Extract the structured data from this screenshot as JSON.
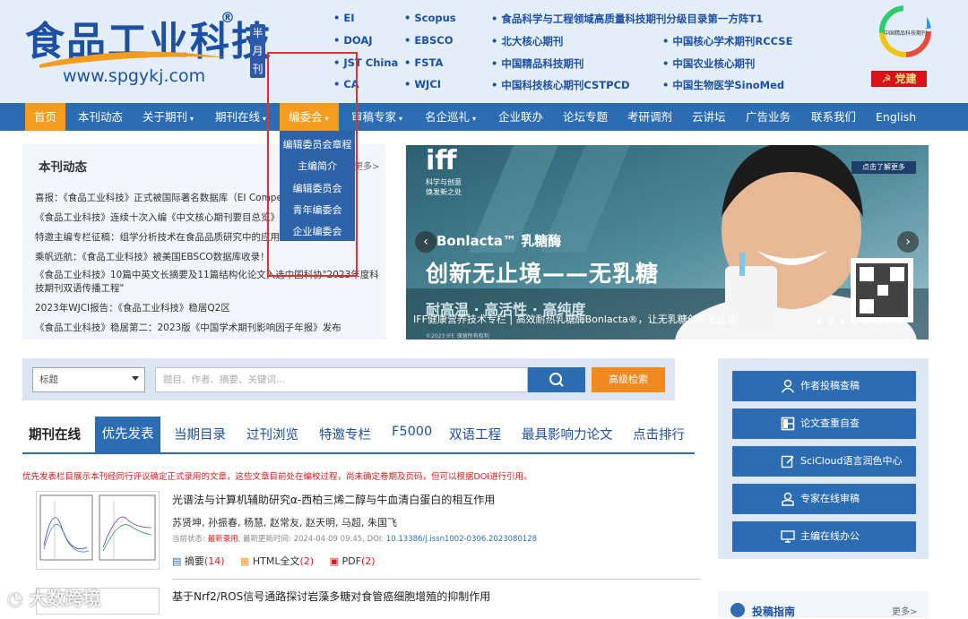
{
  "header": {
    "logo_text": "食品工业科技",
    "logo_url": "www.spgykj.com",
    "halfmonth": "半月刊",
    "index_col1": [
      "EI",
      "DOAJ",
      "JST China",
      "CA"
    ],
    "index_col2": [
      "Scopus",
      "EBSCO",
      "FSTA",
      "WJCI"
    ],
    "index_col3": [
      "食品科学与工程领域高质量科技期刊分级目录第一方阵T1",
      "北大核心期刊",
      "中国精品科技期刊",
      "中国科技核心期刊CSTPCD"
    ],
    "index_col4": [
      "中国核心学术期刊RCCSE",
      "中国农业核心期刊",
      "中国生物医学SinoMed"
    ],
    "party_button": "党建",
    "cert_text": "中国精品科技期刊"
  },
  "nav": {
    "items": [
      {
        "label": "首页"
      },
      {
        "label": "本刊动态"
      },
      {
        "label": "关于期刊"
      },
      {
        "label": "期刊在线"
      },
      {
        "label": "编委会"
      },
      {
        "label": "审稿专家"
      },
      {
        "label": "名企巡礼"
      },
      {
        "label": "企业联办"
      },
      {
        "label": "论坛专题"
      },
      {
        "label": "考研调剂"
      },
      {
        "label": "云讲坛"
      },
      {
        "label": "广告业务"
      },
      {
        "label": "联系我们"
      },
      {
        "label": "English"
      }
    ]
  },
  "dropdown": {
    "items": [
      "编辑委员会章程",
      "主编简介",
      "编辑委员会",
      "青年编委会",
      "企业编委会"
    ]
  },
  "news": {
    "title": "本刊动态",
    "more": "更多>",
    "items": [
      "喜报：《食品工业科技》正式被国际著名数据库（EI Compendex）收录",
      "《食品工业科技》连续十次入编《中文核心期刊要目总览》",
      "特邀主编专栏征稿：组学分析技术在食品品质研究中的应用",
      "乘帆远航：《食品工业科技》被美国EBSCO数据库收录！",
      "《食品工业科技》10篇中英文长摘要及11篇结构化论文入选中国科协\"2023年度科技期刊双语传播工程\"",
      "2023年WJCI报告：《食品工业科技》稳居Q2区",
      "《食品工业科技》稳居第二：2023版《中国学术期刊影响因子年报》发布"
    ]
  },
  "banner": {
    "brand": "iff",
    "brand_sub": "科学与创意\n焕发新之处",
    "product": "Bonlacta™ 乳糖酶",
    "slogan": "创新无止境——无乳糖",
    "tagline": "耐高温 · 高活性 · 高纯度",
    "cta": "点击了解更多",
    "caption": "IFF健康营养技术专栏 | 高效耐热乳糖酶Bonlacta®，让无乳糖创新无止境",
    "copyright": "©2023 IFF. 保留所有权利",
    "active_dot": 0,
    "dot_count": 8
  },
  "search": {
    "select_value": "标题",
    "placeholder": "题目、作者、摘要、关键词...",
    "advanced_label": "高级检索"
  },
  "tabs": {
    "items": [
      "期刊在线",
      "优先发表",
      "当期目录",
      "过刊浏览",
      "特邀专栏",
      "F5000",
      "双语工程",
      "最具影响力论文",
      "点击排行"
    ],
    "active": "优先发表"
  },
  "notice": "优先发表栏目展示本刊经同行评议确定正式录用的文章，这些文章目前处在编校过程，尚未确定卷期及页码，但可以根据DOI进行引用。",
  "articles": [
    {
      "title": "光谱法与计算机辅助研究α-西柏三烯二醇与牛血清白蛋白的相互作用",
      "authors": "苏贤坤, 孙振春, 杨慧, 赵常友, 赵天明, 马超, 朱国飞",
      "status_label": "当前状态:",
      "status": "最新录用",
      "meta": ", 最新更新时间: 2024-04-09 09:45, DOI:",
      "doi": "10.13386/j.issn1002-0306.2023080128",
      "abstract_label": "摘要",
      "abstract_count": "(14)",
      "html_label": "HTML全文",
      "html_count": "(2)",
      "pdf_label": "PDF",
      "pdf_count": "(2)"
    },
    {
      "title": "基于Nrf2/ROS信号通路探讨岩藻多糖对食管癌细胞增殖的抑制作用"
    }
  ],
  "side": {
    "buttons": [
      "作者投稿查稿",
      "论文查重自查",
      "SciCloud语言润色中心",
      "专家在线审稿",
      "主编在线办公"
    ],
    "guide_title": "投稿指南",
    "guide_more": "更多>"
  },
  "watermark": "大数跨境"
}
